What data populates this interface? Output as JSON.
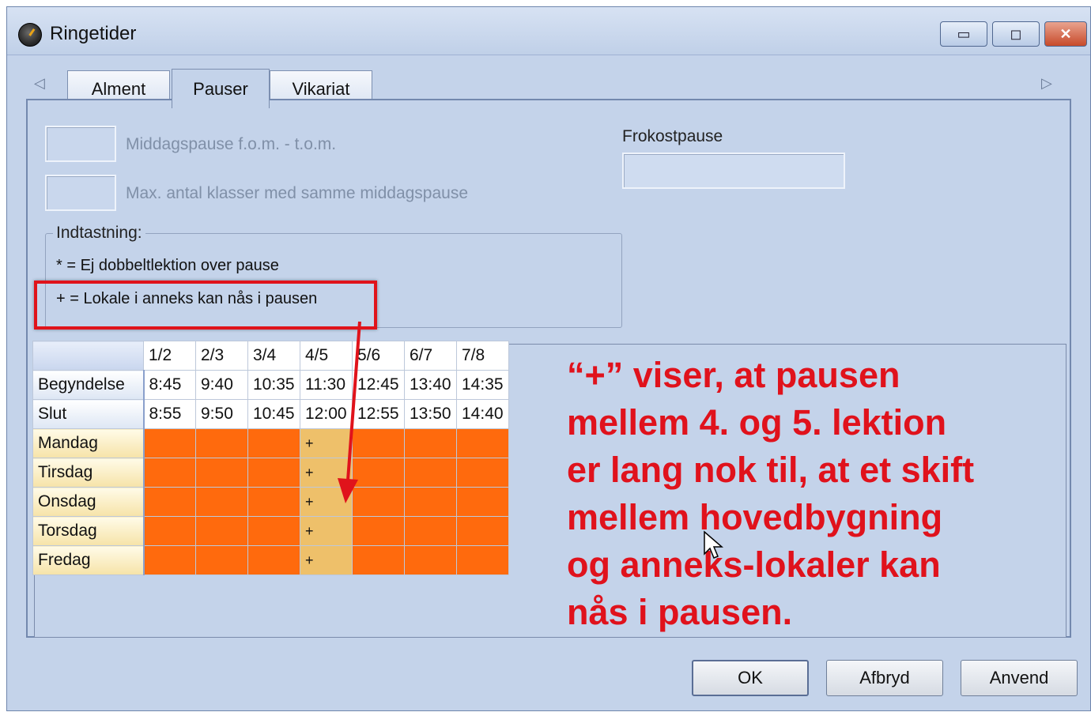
{
  "window": {
    "title": "Ringetider"
  },
  "title_buttons": {
    "minimize": "▭",
    "maximize": "◻",
    "close": "✕"
  },
  "tabs": [
    "Alment",
    "Pauser",
    "Vikariat"
  ],
  "active_tab": "Pauser",
  "scroll": {
    "left": "◁",
    "right": "▷"
  },
  "form": {
    "midday_label": "Middagspause f.o.m. - t.o.m.",
    "midday_value": "",
    "max_label": "Max. antal klasser med samme middagspause",
    "max_value": "",
    "lunch_label": "Frokostpause",
    "lunch_value": ""
  },
  "legend": {
    "title": "Indtastning:",
    "line1": "* = Ej dobbeltlektion over pause",
    "line2": "+ = Lokale i anneks kan nås i pausen"
  },
  "grid": {
    "columns": [
      "1/2",
      "2/3",
      "3/4",
      "4/5",
      "5/6",
      "6/7",
      "7/8"
    ],
    "start_label": "Begyndelse",
    "start_times": [
      "8:45",
      "9:40",
      "10:35",
      "11:30",
      "12:45",
      "13:40",
      "14:35"
    ],
    "end_label": "Slut",
    "end_times": [
      "8:55",
      "9:50",
      "10:45",
      "12:00",
      "12:55",
      "13:50",
      "14:40"
    ],
    "days": [
      "Mandag",
      "Tirsdag",
      "Onsdag",
      "Torsdag",
      "Fredag"
    ],
    "plus_mark": "+",
    "plus_column": "4/5"
  },
  "annotation": "“+” viser, at pausen\nmellem 4. og 5. lektion\ner lang nok til, at et skift\nmellem hovedbygning\nog anneks-lokaler kan\nnås i pausen.",
  "buttons": {
    "ok": "OK",
    "cancel": "Afbryd",
    "apply": "Anvend"
  },
  "colors": {
    "break_cell": "#ff6a0d",
    "annex_cell": "#eec06a",
    "highlight": "#e0131b"
  }
}
